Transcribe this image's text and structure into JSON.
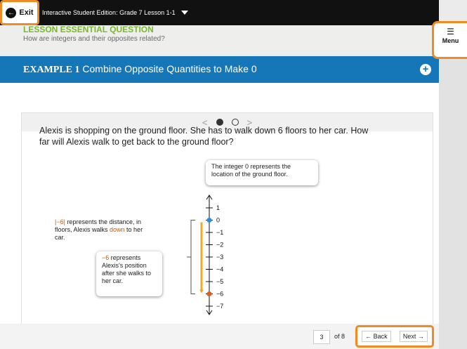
{
  "topbar": {
    "exit_label": "Exit",
    "exit_icon": "arrow-left-circle-icon",
    "edition_title": "Interactive Student Edition: Grade 7 Lesson 1-1"
  },
  "essential": {
    "title": "LESSON ESSENTIAL QUESTION",
    "question": "How are integers and their opposites related?"
  },
  "menu": {
    "icon": "hamburger-icon",
    "label": "Menu"
  },
  "example": {
    "prefix": "EXAMPLE 1",
    "title": "Combine Opposite Quantities to Make 0"
  },
  "pager": {
    "prev": "<",
    "next": ">",
    "current_slide": 1,
    "total_slides": 2
  },
  "problem": {
    "text": "Alexis is shopping on the ground floor. She has to walk down 6 floors to her car. How far will Alexis walk to get back to the ground floor?"
  },
  "numberline": {
    "ticks": [
      "1",
      "0",
      "−1",
      "−2",
      "−3",
      "−4",
      "−5",
      "−6",
      "−7"
    ],
    "colors": {
      "zero_point": "#2a8fd1",
      "neg6_point": "#e05a1a",
      "bar": "#f0a828"
    }
  },
  "callouts": {
    "zero": "The integer 0 represents the location of the ground floor.",
    "neg6_value": "−6",
    "neg6_text": " represents Alexis's position after she walks to her car."
  },
  "annotation": {
    "abs_value": "|−6|",
    "part1": " represents the distance, in floors, Alexis walks ",
    "down": "down",
    "part2": " to her car."
  },
  "footer": {
    "page": "3",
    "of": "of 8",
    "back": "← Back",
    "next": "Next →"
  }
}
